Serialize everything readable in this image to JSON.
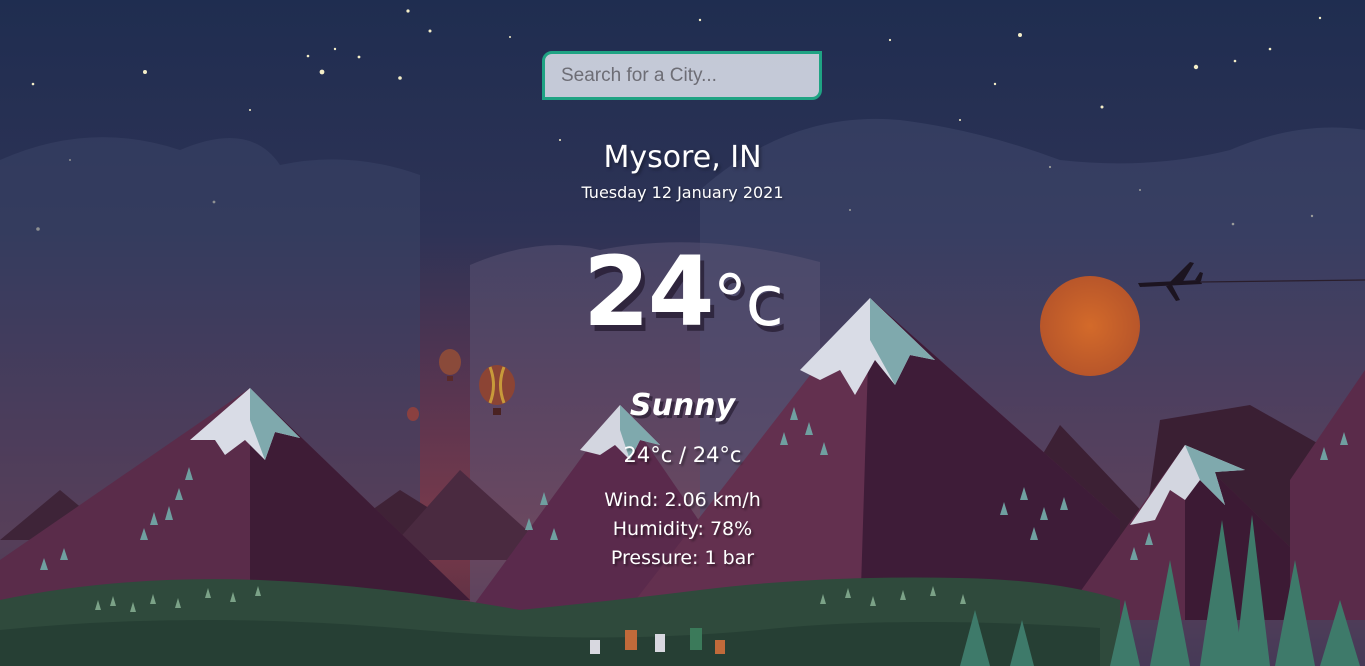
{
  "search": {
    "placeholder": "Search for a City...",
    "value": ""
  },
  "weather": {
    "location": "Mysore, IN",
    "date": "Tuesday 12 January 2021",
    "temperature": "24",
    "temperature_unit": "°c",
    "condition": "Sunny",
    "hi_lo": "24°c / 24°c",
    "wind": "Wind: 2.06 km/h",
    "humidity": "Humidity: 78%",
    "pressure": "Pressure: 1 bar"
  },
  "colors": {
    "search_border": "#1fa383",
    "sky_top": "#1f2d50",
    "sky_bottom": "#7a3a4a",
    "sun": "#c9632a"
  }
}
